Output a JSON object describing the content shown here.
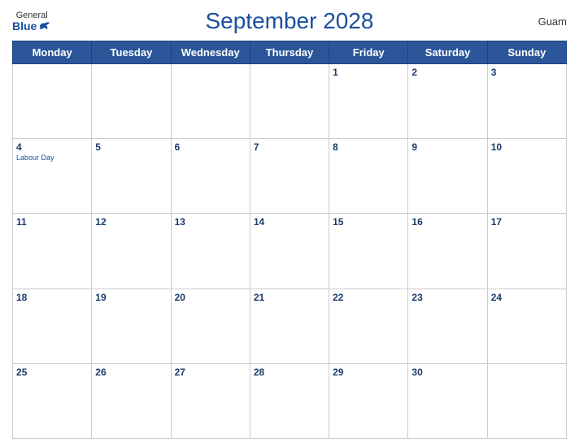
{
  "header": {
    "logo_general": "General",
    "logo_blue": "Blue",
    "title": "September 2028",
    "country": "Guam"
  },
  "calendar": {
    "days_of_week": [
      "Monday",
      "Tuesday",
      "Wednesday",
      "Thursday",
      "Friday",
      "Saturday",
      "Sunday"
    ],
    "weeks": [
      [
        {
          "day": "",
          "empty": true
        },
        {
          "day": "",
          "empty": true
        },
        {
          "day": "",
          "empty": true
        },
        {
          "day": "",
          "empty": true
        },
        {
          "day": "1",
          "empty": false
        },
        {
          "day": "2",
          "empty": false
        },
        {
          "day": "3",
          "empty": false
        }
      ],
      [
        {
          "day": "4",
          "holiday": "Labour Day",
          "empty": false
        },
        {
          "day": "5",
          "empty": false
        },
        {
          "day": "6",
          "empty": false
        },
        {
          "day": "7",
          "empty": false
        },
        {
          "day": "8",
          "empty": false
        },
        {
          "day": "9",
          "empty": false
        },
        {
          "day": "10",
          "empty": false
        }
      ],
      [
        {
          "day": "11",
          "empty": false
        },
        {
          "day": "12",
          "empty": false
        },
        {
          "day": "13",
          "empty": false
        },
        {
          "day": "14",
          "empty": false
        },
        {
          "day": "15",
          "empty": false
        },
        {
          "day": "16",
          "empty": false
        },
        {
          "day": "17",
          "empty": false
        }
      ],
      [
        {
          "day": "18",
          "empty": false
        },
        {
          "day": "19",
          "empty": false
        },
        {
          "day": "20",
          "empty": false
        },
        {
          "day": "21",
          "empty": false
        },
        {
          "day": "22",
          "empty": false
        },
        {
          "day": "23",
          "empty": false
        },
        {
          "day": "24",
          "empty": false
        }
      ],
      [
        {
          "day": "25",
          "empty": false
        },
        {
          "day": "26",
          "empty": false
        },
        {
          "day": "27",
          "empty": false
        },
        {
          "day": "28",
          "empty": false
        },
        {
          "day": "29",
          "empty": false
        },
        {
          "day": "30",
          "empty": false
        },
        {
          "day": "",
          "empty": true
        }
      ]
    ]
  }
}
